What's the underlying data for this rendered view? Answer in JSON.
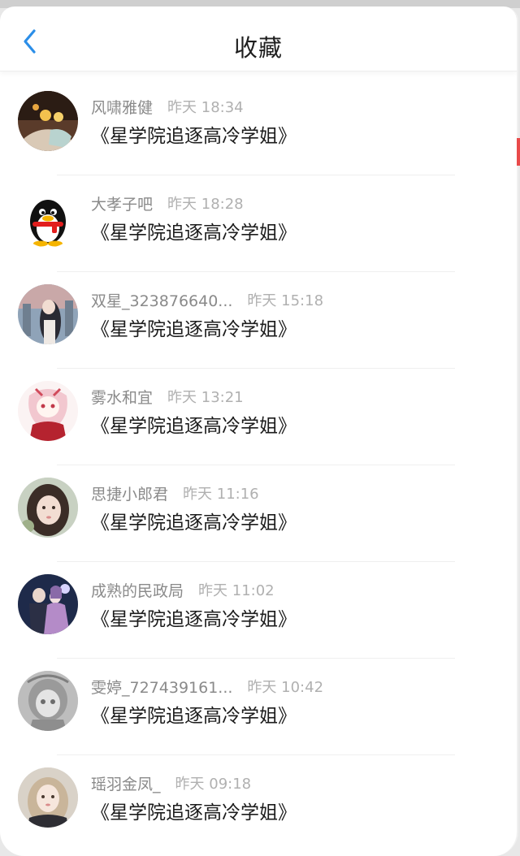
{
  "header": {
    "title": "收藏",
    "back_icon": "chevron-left-icon"
  },
  "colors": {
    "accent": "#2b8ee8",
    "name": "#8a8a8a",
    "time": "#b0b0b0",
    "title": "#1c1c1c"
  },
  "favorites": [
    {
      "user": "风啸雅健",
      "time": "昨天 18:34",
      "book": "《星学院追逐高冷学姐》",
      "avatar": "avatar-1"
    },
    {
      "user": "大孝子吧",
      "time": "昨天 18:28",
      "book": "《星学院追逐高冷学姐》",
      "avatar": "qq-penguin-avatar"
    },
    {
      "user": "双星_323876640...",
      "time": "昨天 15:18",
      "book": "《星学院追逐高冷学姐》",
      "avatar": "avatar-3"
    },
    {
      "user": "雾水和宜",
      "time": "昨天 13:21",
      "book": "《星学院追逐高冷学姐》",
      "avatar": "avatar-4"
    },
    {
      "user": "思捷小郎君",
      "time": "昨天 11:16",
      "book": "《星学院追逐高冷学姐》",
      "avatar": "avatar-5"
    },
    {
      "user": "成熟的民政局",
      "time": "昨天 11:02",
      "book": "《星学院追逐高冷学姐》",
      "avatar": "avatar-6"
    },
    {
      "user": "雯婷_727439161...",
      "time": "昨天 10:42",
      "book": "《星学院追逐高冷学姐》",
      "avatar": "avatar-7"
    },
    {
      "user": "瑶羽金凤_",
      "time": "昨天 09:18",
      "book": "《星学院追逐高冷学姐》",
      "avatar": "avatar-8"
    }
  ]
}
